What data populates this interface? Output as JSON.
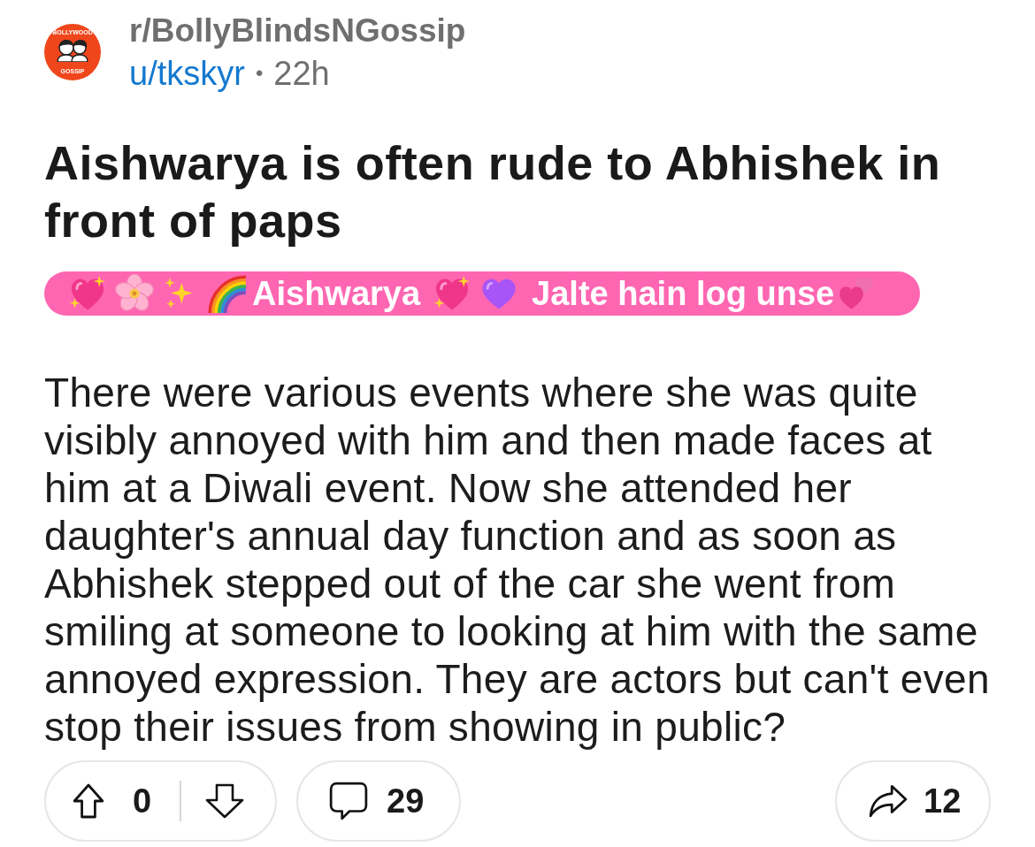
{
  "header": {
    "avatar": {
      "top_text": "BOLLYWOOD",
      "bottom_text": "GOSSIP"
    },
    "subreddit": "r/BollyBlindsNGossip",
    "author": "u/tkskyr",
    "separator": "•",
    "age": "22h"
  },
  "title": "Aishwarya is often rude to Abhishek in front of paps",
  "flair": {
    "text_1": "Aishwarya",
    "text_2": "Jalte hain log unse"
  },
  "body": "There were various events where she was quite visibly annoyed with him and then made faces at him at a Diwali event. Now she attended her daughter's annual day function and as soon as Abhishek stepped out of the car she went from smiling at someone to looking at him with the same annoyed expression. They are actors but can't even stop their issues from showing in public?",
  "actions": {
    "score": "0",
    "comments": "29",
    "shares": "12"
  }
}
